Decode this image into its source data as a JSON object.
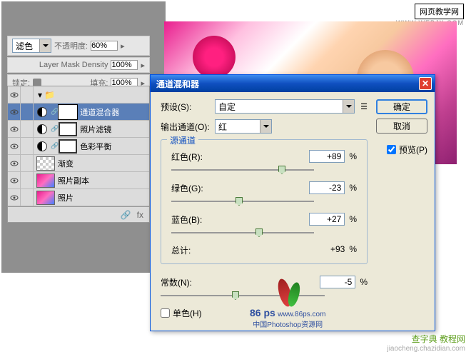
{
  "watermark": {
    "top1": "网页教学网",
    "top2": "WWW.WEBJX.COM",
    "logo_text": "86 ps",
    "logo_url": "www.86ps.com",
    "logo_sub": "中国Photoshop资源网",
    "br1": "查字典 教程网",
    "br2": "jiaocheng.chazidian.com"
  },
  "layers_panel": {
    "blend_mode": "滤色",
    "opacity_label": "不透明度:",
    "opacity_value": "60%",
    "mask_density_label": "Layer Mask Density",
    "mask_density_value": "100%",
    "lock_label": "锁定:",
    "fill_label": "填充:",
    "fill_value": "100%",
    "items": [
      {
        "name": "通道混合器"
      },
      {
        "name": "照片滤镜"
      },
      {
        "name": "色彩平衡"
      },
      {
        "name": "渐变"
      },
      {
        "name": "照片副本"
      },
      {
        "name": "照片"
      }
    ],
    "footer_fx": "fx"
  },
  "dialog": {
    "title": "通道混和器",
    "preset_label": "预设(S):",
    "preset_value": "自定",
    "output_label": "输出通道(O):",
    "output_value": "红",
    "ok": "确定",
    "cancel": "取消",
    "preview": "预览(P)",
    "source_legend": "源通道",
    "sliders": {
      "red_label": "红色(R):",
      "red_value": "+89",
      "green_label": "绿色(G):",
      "green_value": "-23",
      "blue_label": "蓝色(B):",
      "blue_value": "+27"
    },
    "total_label": "总计:",
    "total_value": "+93",
    "constant_label": "常数(N):",
    "constant_value": "-5",
    "mono_label": "单色(H)",
    "pct": "%"
  }
}
